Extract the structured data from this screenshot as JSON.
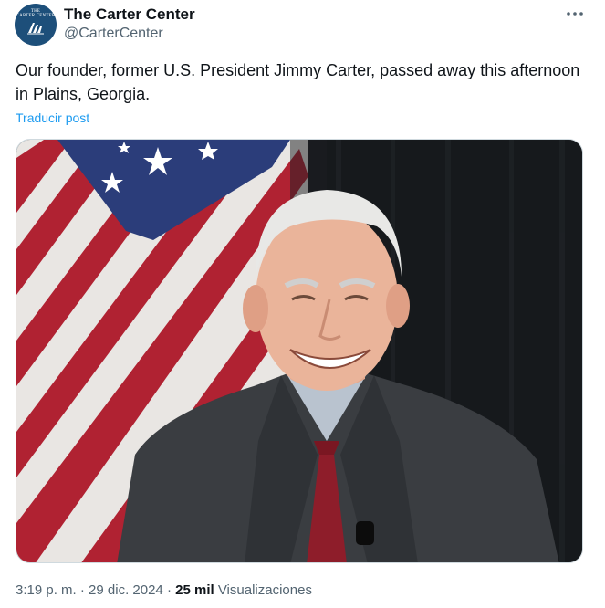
{
  "account": {
    "name": "The Carter Center",
    "handle": "@CarterCenter",
    "avatar_text_line1": "THE",
    "avatar_text_line2": "CARTER CENTER",
    "avatar_color": "#1d4f7a"
  },
  "tweet": {
    "text": "Our founder, former U.S. President Jimmy Carter, passed away this afternoon in Plains, Georgia.",
    "translate_label": "Traducir post",
    "more_icon": "more-dots-icon"
  },
  "media": {
    "description_icon": "photo"
  },
  "meta": {
    "time": "3:19 p. m.",
    "separator": "·",
    "date": "29 dic. 2024",
    "views_count": "25 mil",
    "views_label": "Visualizaciones"
  },
  "colors": {
    "text": "#0f1419",
    "secondary": "#536471",
    "link": "#1d9bf0"
  }
}
